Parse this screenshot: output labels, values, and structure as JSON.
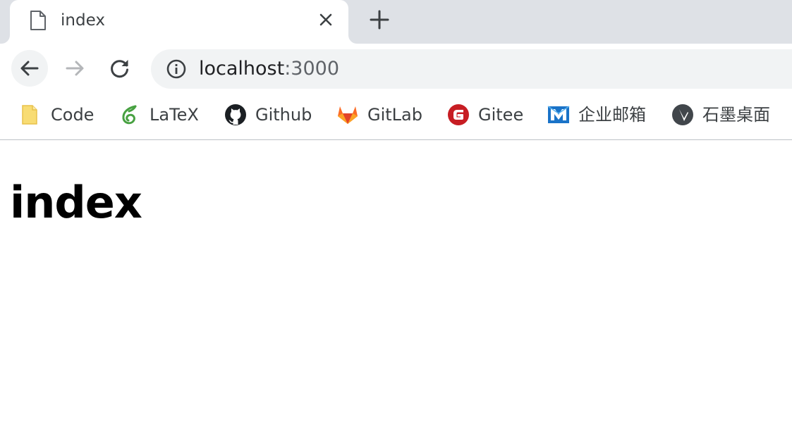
{
  "tab": {
    "title": "index",
    "favicon": "document-icon",
    "close": "close-icon"
  },
  "new_tab": "plus-icon",
  "toolbar": {
    "back": "back-arrow-icon",
    "forward": "forward-arrow-icon",
    "reload": "reload-icon"
  },
  "omnibox": {
    "info": "info-icon",
    "host": "localhost",
    "port": ":3000"
  },
  "bookmarks": [
    {
      "label": "Code",
      "icon": "folder-icon",
      "color": "#f5d66b"
    },
    {
      "label": "LaTeX",
      "icon": "overleaf-icon",
      "color": "#47a141"
    },
    {
      "label": "Github",
      "icon": "github-icon",
      "color": "#1b1f23"
    },
    {
      "label": "GitLab",
      "icon": "gitlab-icon",
      "color": "#fc6d26"
    },
    {
      "label": "Gitee",
      "icon": "gitee-icon",
      "color": "#c71d23"
    },
    {
      "label": "企业邮箱",
      "icon": "mail-icon",
      "color": "#1a73c8"
    },
    {
      "label": "石墨桌面",
      "icon": "shimo-icon",
      "color": "#41464b"
    }
  ],
  "page": {
    "heading": "index"
  }
}
